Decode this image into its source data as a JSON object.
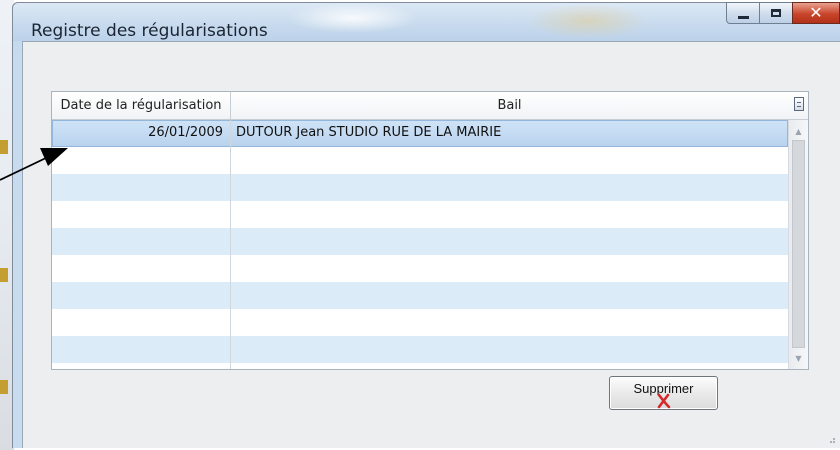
{
  "window": {
    "title": "Registre des régularisations",
    "buttons": {
      "minimize": "minimize-icon",
      "maximize": "maximize-icon",
      "close": "close-icon"
    }
  },
  "grid": {
    "columns": [
      "Date de la régularisation",
      "Bail"
    ],
    "rows": [
      {
        "date": "26/01/2009",
        "bail": "DUTOUR Jean STUDIO RUE DE LA MAIRIE"
      }
    ],
    "empty_rows": 8
  },
  "actions": {
    "delete_label": "Supprimer",
    "delete_icon": "red-x-icon"
  },
  "colors": {
    "row_alt": "#dcebf8",
    "row_selected": "#c5dcf3",
    "delete_x": "#d4282a",
    "close_button": "#c8452b"
  }
}
